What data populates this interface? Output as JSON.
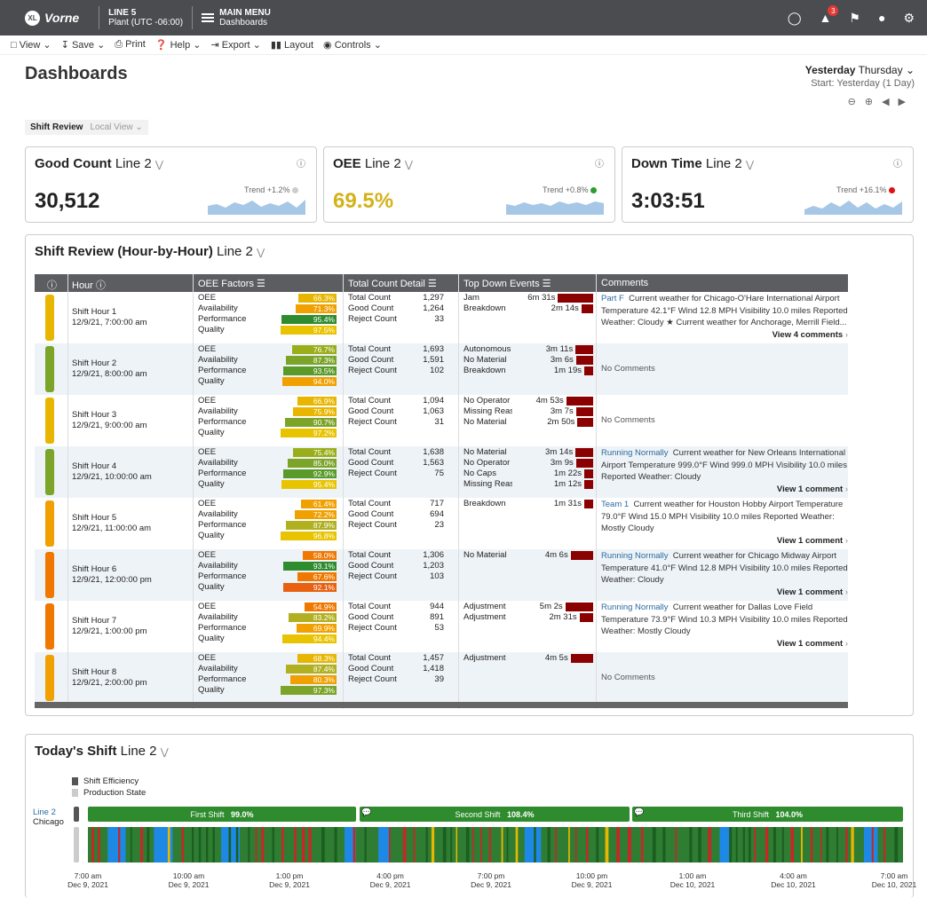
{
  "topbar": {
    "brand": "Vorne",
    "brand_badge": "XL",
    "line_name": "LINE 5",
    "plant": "Plant (UTC -06:00)",
    "menu_title": "MAIN MENU",
    "menu_sub": "Dashboards",
    "notification_count": "3"
  },
  "toolbar": {
    "view": "View",
    "save": "Save",
    "print": "Print",
    "help": "Help",
    "export": "Export",
    "layout": "Layout",
    "controls": "Controls"
  },
  "page": {
    "title": "Dashboards",
    "date_main": "Yesterday",
    "date_day": "Thursday",
    "date_sub": "Start: Yesterday (1 Day)"
  },
  "tabs": {
    "active": "Shift Review",
    "inactive": "Local View"
  },
  "kpis": [
    {
      "title": "Good Count",
      "line": "Line 2",
      "value": "30,512",
      "trend": "Trend +1.2%",
      "color": "#222222",
      "dot": "#cccccc"
    },
    {
      "title": "OEE",
      "line": "Line 2",
      "value": "69.5%",
      "trend": "Trend +0.8%",
      "color": "#d4b21a",
      "dot": "#2e9c2e"
    },
    {
      "title": "Down Time",
      "line": "Line 2",
      "value": "3:03:51",
      "trend": "Trend +16.1%",
      "color": "#222222",
      "dot": "#dd1111"
    }
  ],
  "shift_review": {
    "title": "Shift Review (Hour-by-Hour)",
    "line": "Line 2",
    "headers": {
      "info": "i",
      "hour": "Hour",
      "oee": "OEE Factors",
      "count": "Total Count Detail",
      "down": "Top Down Events",
      "comments": "Comments"
    },
    "factor_labels": [
      "OEE",
      "Availability",
      "Performance",
      "Quality"
    ],
    "count_labels": [
      "Total Count",
      "Good Count",
      "Reject Count"
    ],
    "rows": [
      {
        "name": "Shift Hour 1",
        "date": "12/9/21, 7:00:00 am",
        "ind": "#e8b600",
        "factors": [
          {
            "v": "66.3%",
            "c": "#e8b600",
            "w": 66
          },
          {
            "v": "71.3%",
            "c": "#f0a000",
            "w": 71
          },
          {
            "v": "95.4%",
            "c": "#2e8b2e",
            "w": 95
          },
          {
            "v": "97.5%",
            "c": "#e8c400",
            "w": 97
          }
        ],
        "counts": [
          "1,297",
          "1,264",
          "33"
        ],
        "downs": [
          {
            "l": "Jam",
            "t": "6m 31s",
            "w": 72
          },
          {
            "l": "Breakdown",
            "t": "2m 14s",
            "w": 24
          }
        ],
        "comment_link": "Part F",
        "comment": "Current weather for Chicago-O'Hare International Airport Temperature 42.1°F Wind 12.8 MPH Visibility 10.0 miles Reported Weather: Cloudy ★ Current weather for Anchorage, Merrill Field...",
        "more": "View 4 comments"
      },
      {
        "name": "Shift Hour 2",
        "date": "12/9/21, 8:00:00 am",
        "ind": "#7ba428",
        "factors": [
          {
            "v": "76.7%",
            "c": "#9aae1a",
            "w": 77
          },
          {
            "v": "87.3%",
            "c": "#7ba428",
            "w": 87
          },
          {
            "v": "93.5%",
            "c": "#5a9a28",
            "w": 93
          },
          {
            "v": "94.0%",
            "c": "#f0a000",
            "w": 94
          }
        ],
        "counts": [
          "1,693",
          "1,591",
          "102"
        ],
        "downs": [
          {
            "l": "Autonomous ...",
            "t": "3m 11s",
            "w": 36
          },
          {
            "l": "No Material",
            "t": "3m 6s",
            "w": 35
          },
          {
            "l": "Breakdown",
            "t": "1m 19s",
            "w": 15
          }
        ],
        "comment_link": "",
        "comment": "No Comments",
        "more": ""
      },
      {
        "name": "Shift Hour 3",
        "date": "12/9/21, 9:00:00 am",
        "ind": "#e8b600",
        "factors": [
          {
            "v": "66.9%",
            "c": "#e8b600",
            "w": 67
          },
          {
            "v": "75.9%",
            "c": "#e8b600",
            "w": 76
          },
          {
            "v": "90.7%",
            "c": "#7ba428",
            "w": 90
          },
          {
            "v": "97.2%",
            "c": "#e8c400",
            "w": 97
          }
        ],
        "counts": [
          "1,094",
          "1,063",
          "31"
        ],
        "downs": [
          {
            "l": "No Operator",
            "t": "4m 53s",
            "w": 55
          },
          {
            "l": "Missing Reason",
            "t": "3m 7s",
            "w": 35
          },
          {
            "l": "No Material",
            "t": "2m 50s",
            "w": 32
          }
        ],
        "comment_link": "",
        "comment": "No Comments",
        "more": ""
      },
      {
        "name": "Shift Hour 4",
        "date": "12/9/21, 10:00:00 am",
        "ind": "#7ba428",
        "factors": [
          {
            "v": "75.4%",
            "c": "#9aae1a",
            "w": 75
          },
          {
            "v": "85.0%",
            "c": "#7ba428",
            "w": 85
          },
          {
            "v": "92.9%",
            "c": "#5a9a28",
            "w": 93
          },
          {
            "v": "95.4%",
            "c": "#e8c400",
            "w": 95
          }
        ],
        "counts": [
          "1,638",
          "1,563",
          "75"
        ],
        "downs": [
          {
            "l": "No Material",
            "t": "3m 14s",
            "w": 36
          },
          {
            "l": "No Operator",
            "t": "3m 9s",
            "w": 35
          },
          {
            "l": "No Caps",
            "t": "1m 22s",
            "w": 16
          },
          {
            "l": "Missing Reason",
            "t": "1m 12s",
            "w": 14
          }
        ],
        "comment_link": "Running Normally",
        "comment": "Current weather for New Orleans International Airport Temperature 999.0°F Wind 999.0 MPH Visibility 10.0 miles Reported Weather: Cloudy",
        "more": "View 1 comment"
      },
      {
        "name": "Shift Hour 5",
        "date": "12/9/21, 11:00:00 am",
        "ind": "#f0a000",
        "factors": [
          {
            "v": "61.4%",
            "c": "#f0a000",
            "w": 61
          },
          {
            "v": "72.2%",
            "c": "#f0a000",
            "w": 72
          },
          {
            "v": "87.9%",
            "c": "#b0b020",
            "w": 88
          },
          {
            "v": "96.8%",
            "c": "#e8c400",
            "w": 97
          }
        ],
        "counts": [
          "717",
          "694",
          "23"
        ],
        "downs": [
          {
            "l": "Breakdown",
            "t": "1m 31s",
            "w": 17
          }
        ],
        "comment_link": "Team 1",
        "comment": "Current weather for Houston Hobby Airport Temperature 79.0°F Wind 15.0 MPH Visibility 10.0 miles Reported Weather: Mostly Cloudy",
        "more": "View 1 comment"
      },
      {
        "name": "Shift Hour 6",
        "date": "12/9/21, 12:00:00 pm",
        "ind": "#f07800",
        "factors": [
          {
            "v": "58.0%",
            "c": "#f07800",
            "w": 58
          },
          {
            "v": "93.1%",
            "c": "#2e8b2e",
            "w": 93
          },
          {
            "v": "67.6%",
            "c": "#f07800",
            "w": 68
          },
          {
            "v": "92.1%",
            "c": "#e86010",
            "w": 92
          }
        ],
        "counts": [
          "1,306",
          "1,203",
          "103"
        ],
        "downs": [
          {
            "l": "No Material",
            "t": "4m 6s",
            "w": 46
          }
        ],
        "comment_link": "Running Normally",
        "comment": "Current weather for Chicago Midway Airport Temperature 41.0°F Wind 12.8 MPH Visibility 10.0 miles Reported Weather: Cloudy",
        "more": "View 1 comment"
      },
      {
        "name": "Shift Hour 7",
        "date": "12/9/21, 1:00:00 pm",
        "ind": "#f07800",
        "factors": [
          {
            "v": "54.9%",
            "c": "#f07800",
            "w": 55
          },
          {
            "v": "83.2%",
            "c": "#b0b020",
            "w": 83
          },
          {
            "v": "69.9%",
            "c": "#f0a000",
            "w": 70
          },
          {
            "v": "94.4%",
            "c": "#e8c400",
            "w": 94
          }
        ],
        "counts": [
          "944",
          "891",
          "53"
        ],
        "downs": [
          {
            "l": "Adjustment",
            "t": "5m 2s",
            "w": 57
          },
          {
            "l": "Adjustment",
            "t": "2m 31s",
            "w": 28
          }
        ],
        "comment_link": "Running Normally",
        "comment": "Current weather for Dallas Love Field Temperature 73.9°F Wind 10.3 MPH Visibility 10.0 miles Reported Weather: Mostly Cloudy",
        "more": "View 1 comment"
      },
      {
        "name": "Shift Hour 8",
        "date": "12/9/21, 2:00:00 pm",
        "ind": "#f0a000",
        "factors": [
          {
            "v": "68.3%",
            "c": "#e8b600",
            "w": 68
          },
          {
            "v": "87.4%",
            "c": "#b0b020",
            "w": 87
          },
          {
            "v": "80.3%",
            "c": "#f0a000",
            "w": 80
          },
          {
            "v": "97.3%",
            "c": "#7ba428",
            "w": 97
          }
        ],
        "counts": [
          "1,457",
          "1,418",
          "39"
        ],
        "downs": [
          {
            "l": "Adjustment",
            "t": "4m 5s",
            "w": 46
          }
        ],
        "comment_link": "",
        "comment": "No Comments",
        "more": ""
      }
    ]
  },
  "todays_shift": {
    "title": "Today's Shift",
    "line": "Line 2",
    "legend": [
      "Shift Efficiency",
      "Production State"
    ],
    "line_label": "Line 2",
    "location": "Chicago",
    "shifts": [
      {
        "name": "First Shift",
        "pct": "99.0%"
      },
      {
        "name": "Second Shift",
        "pct": "108.4%"
      },
      {
        "name": "Third Shift",
        "pct": "104.0%"
      }
    ],
    "ticks": [
      {
        "time": "7:00 am",
        "date": "Dec 9, 2021"
      },
      {
        "time": "10:00 am",
        "date": "Dec 9, 2021"
      },
      {
        "time": "1:00 pm",
        "date": "Dec 9, 2021"
      },
      {
        "time": "4:00 pm",
        "date": "Dec 9, 2021"
      },
      {
        "time": "7:00 pm",
        "date": "Dec 9, 2021"
      },
      {
        "time": "10:00 pm",
        "date": "Dec 9, 2021"
      },
      {
        "time": "1:00 am",
        "date": "Dec 10, 2021"
      },
      {
        "time": "4:00 am",
        "date": "Dec 10, 2021"
      },
      {
        "time": "7:00 am",
        "date": "Dec 10, 2021"
      }
    ]
  }
}
